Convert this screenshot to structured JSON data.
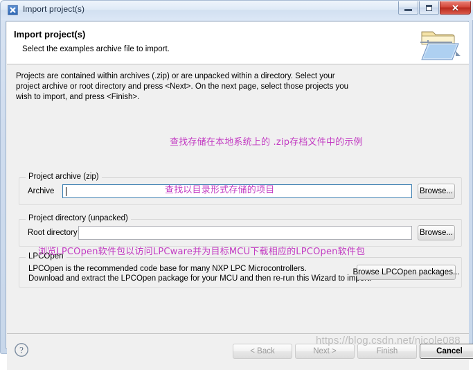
{
  "window": {
    "title": "Import project(s)",
    "icon": "eclipse-wizard-icon",
    "controls": {
      "minimize": "Minimize",
      "maximize": "Maximize",
      "close": "Close"
    }
  },
  "wizard_header": {
    "title": "Import project(s)",
    "subtitle": "Select the examples archive file to import.",
    "icon": "import-folder-icon"
  },
  "intro": {
    "line1": "Projects are contained within archives (.zip) or are unpacked within a directory. Select your",
    "line2": "project archive or root directory and press <Next>. On the next page, select those projects you",
    "line3": "wish to import, and press <Finish>."
  },
  "project_archive": {
    "legend": "Project archive (zip)",
    "field_label": "Archive",
    "value": "",
    "placeholder": "",
    "browse_label": "Browse..."
  },
  "project_directory": {
    "legend": "Project directory (unpacked)",
    "field_label": "Root directory",
    "value": "",
    "placeholder": "",
    "browse_label": "Browse..."
  },
  "lpcopen": {
    "legend": "LPCOpen",
    "line1": "LPCOpen is the recommended code base for many NXP LPC Microcontrollers.",
    "line2": "Download and extract the LPCOpen package for your MCU and then re-run this Wizard to import.",
    "browse_label": "Browse LPCOpen packages..."
  },
  "annotations": {
    "archive": "查找存储在本地系统上的 .zip存档文件中的示例",
    "root_directory": "查找以目录形式存储的项目",
    "lpcopen": "浏览LPCOpen软件包以访问LPCware并为目标MCU下载相应的LPCOpen软件包",
    "color": "#c23ac2"
  },
  "button_bar": {
    "help": "help-icon",
    "back": "< Back",
    "next": "Next >",
    "finish": "Finish",
    "cancel": "Cancel"
  },
  "watermark": {
    "text": "https://blog.csdn.net/nicole088"
  }
}
